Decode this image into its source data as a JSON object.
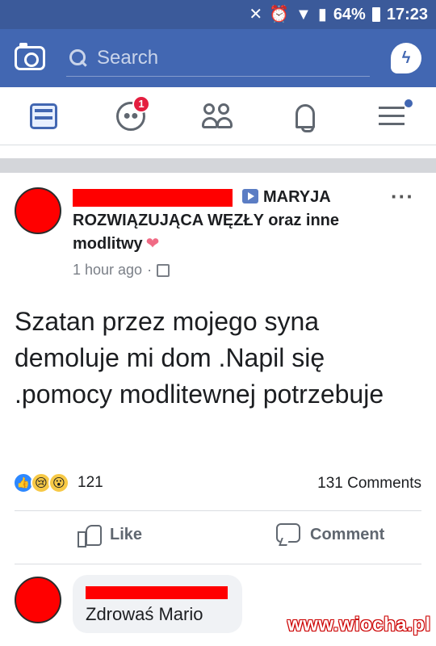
{
  "status_bar": {
    "battery": "64%",
    "time": "17:23",
    "icons": [
      "mute-icon",
      "alarm-icon",
      "wifi-icon",
      "signal-icon",
      "battery-icon"
    ]
  },
  "header": {
    "search_placeholder": "Search",
    "icons": [
      "camera-icon",
      "search-icon",
      "messenger-icon"
    ]
  },
  "nav": {
    "groups_badge": "1",
    "items": [
      "news-feed-icon",
      "groups-icon",
      "friends-icon",
      "notifications-icon",
      "menu-icon"
    ]
  },
  "post": {
    "title_line1": "MARYJA",
    "title_line2": "ROZWIĄZUJĄCA WĘZŁY oraz inne",
    "title_line3": "modlitwy",
    "time": "1 hour ago",
    "more": "···",
    "body": "Szatan przez mojego syna demoluje mi dom .Napil się .pomocy modlitewnej potrzebuje",
    "reaction_count": "121",
    "comments_count": "131 Comments",
    "like_label": "Like",
    "comment_label": "Comment"
  },
  "comment": {
    "text": "Zdrowaś Mario"
  },
  "watermark": "www.wiocha.pl",
  "colors": {
    "status_bar": "#3b5a9a",
    "header": "#4267b2",
    "redaction": "#ff0000",
    "badge": "#e41e3f"
  }
}
